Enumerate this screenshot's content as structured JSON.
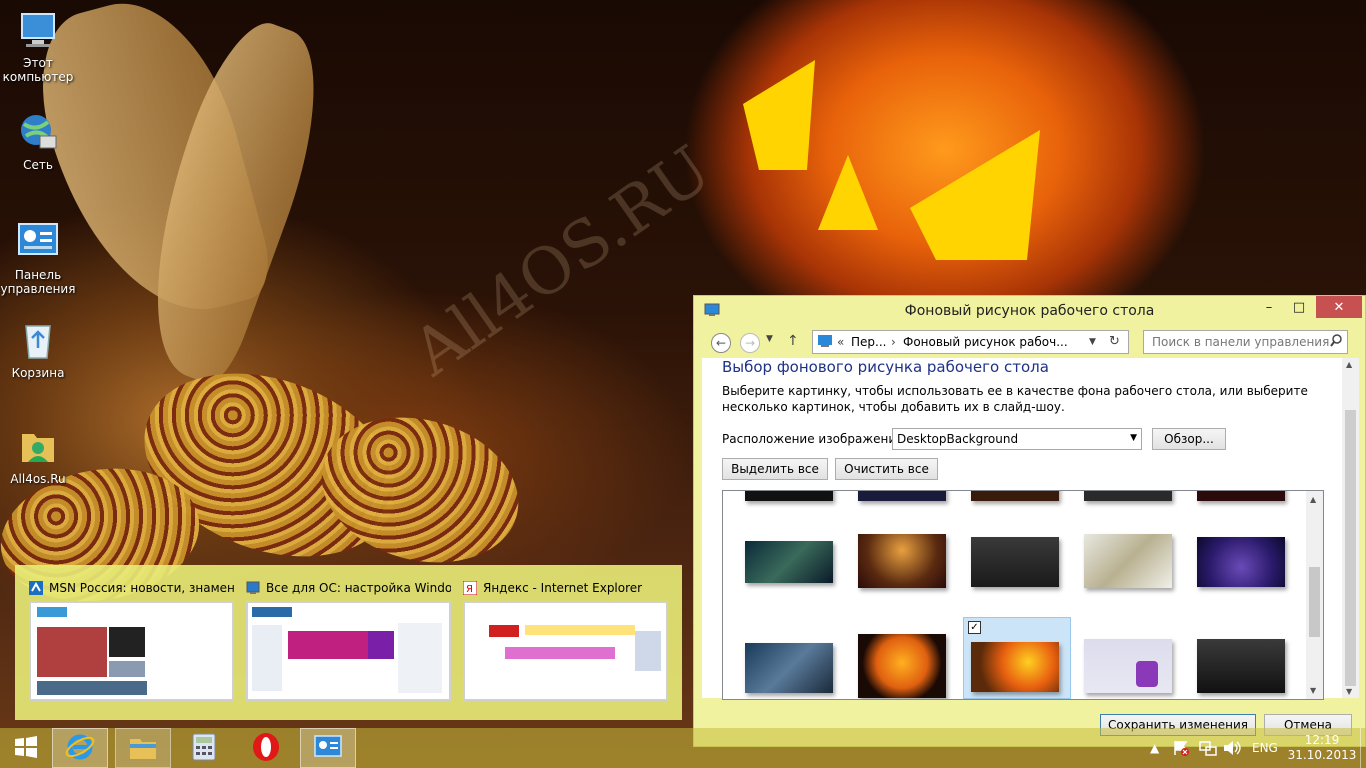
{
  "desktop": {
    "watermark": "All4OS.RU",
    "icons": [
      {
        "label": "Этот компьютер",
        "icon": "computer-icon"
      },
      {
        "label": "Сеть",
        "icon": "network-icon"
      },
      {
        "label": "Панель управления",
        "icon": "control-panel-icon"
      },
      {
        "label": "Корзина",
        "icon": "recycle-bin-icon"
      },
      {
        "label": "All4os.Ru",
        "icon": "folder-user-icon"
      }
    ]
  },
  "thumbnails": [
    {
      "title": "MSN Россия: новости, знамен...",
      "icon": "msn-icon"
    },
    {
      "title": "Все для ОС: настройка Windo...",
      "icon": "ie-page-icon"
    },
    {
      "title": "Яндекс - Internet Explorer",
      "icon": "yandex-icon"
    }
  ],
  "window": {
    "title": "Фоновый рисунок рабочего стола",
    "controls": {
      "minimize": "–",
      "maximize": "□",
      "close": "✕"
    },
    "address": {
      "prefix": "«",
      "crumb1": "Пер...",
      "sep": "›",
      "crumb2": "Фоновый рисунок рабоч..."
    },
    "search_placeholder": "Поиск в панели управления",
    "heading": "Выбор фонового рисунка рабочего стола",
    "description": "Выберите картинку, чтобы использовать ее в качестве фона рабочего стола, или выберите несколько картинок, чтобы добавить их в слайд-шоу.",
    "location_label": "Расположение изображения:",
    "location_value": "DesktopBackground",
    "browse_button": "Обзор...",
    "select_all_button": "Выделить все",
    "clear_all_button": "Очистить все",
    "save_button": "Сохранить изменения",
    "cancel_button": "Отмена",
    "selected_mark": "✓"
  },
  "taskbar": {
    "items": [
      {
        "icon": "start-icon"
      },
      {
        "icon": "internet-explorer-icon"
      },
      {
        "icon": "file-explorer-icon"
      },
      {
        "icon": "calculator-icon"
      },
      {
        "icon": "opera-icon"
      },
      {
        "icon": "control-panel-icon"
      }
    ],
    "language": "ENG",
    "time": "12:19",
    "date": "31.10.2013"
  },
  "colors": {
    "window_tint": "#f0f2a0",
    "close_red": "#c75050",
    "heading_blue": "#1e3287",
    "taskbar_tint": "#c8be3c"
  }
}
